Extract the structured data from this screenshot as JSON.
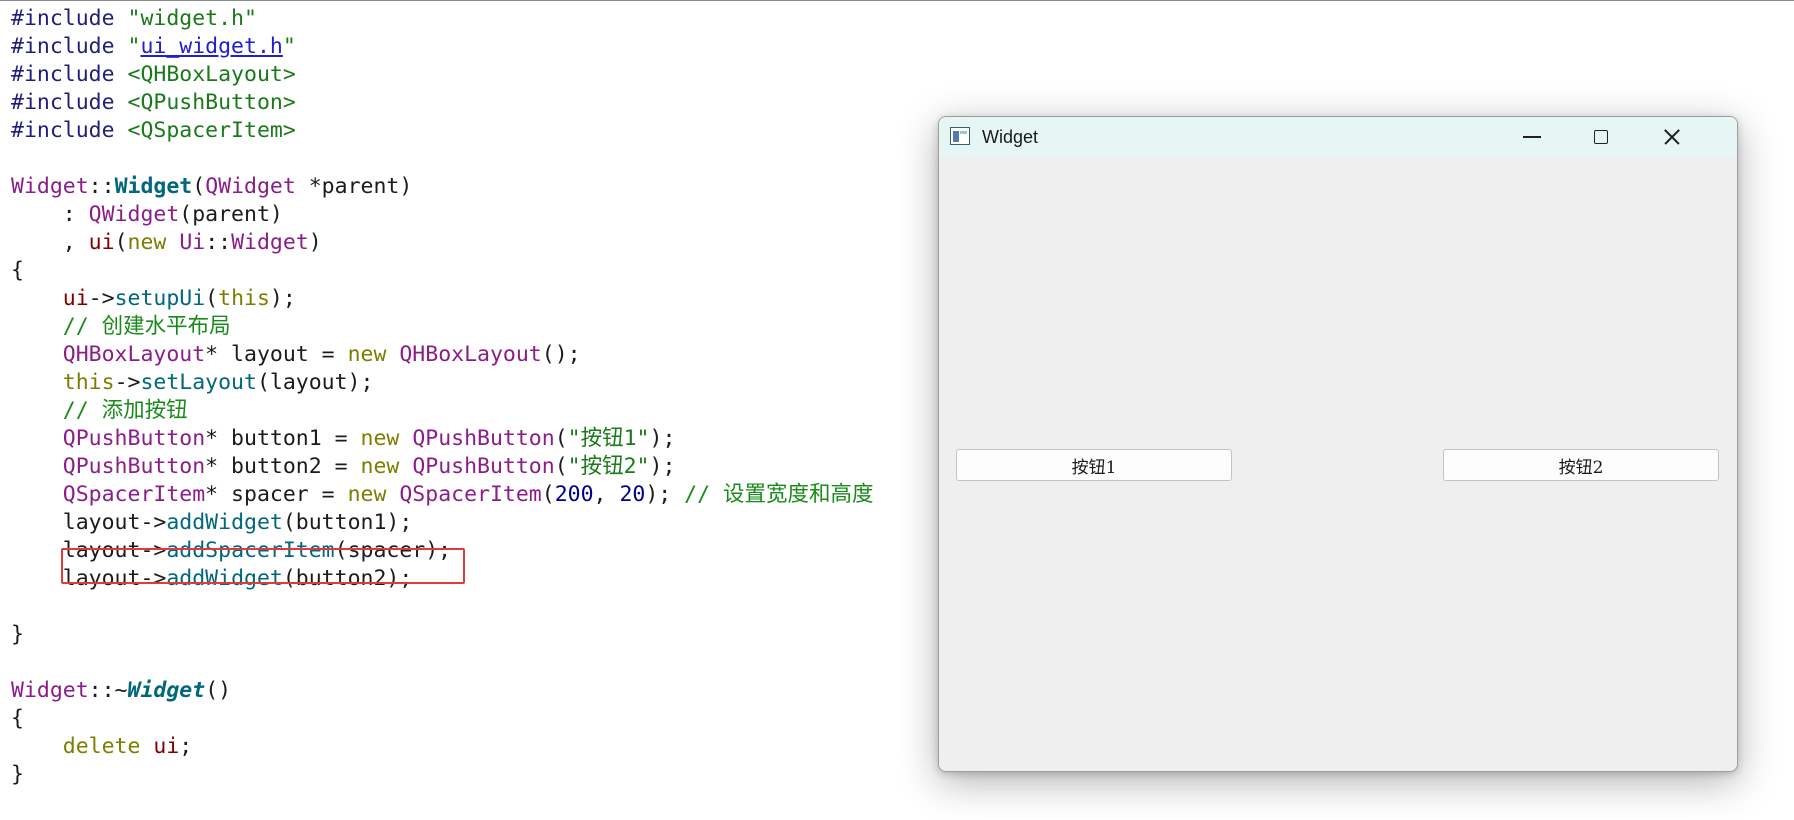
{
  "editor": {
    "lines": [
      {
        "row": 0,
        "tokens": [
          [
            "pp",
            "#include "
          ],
          [
            "str",
            "\"widget.h\""
          ]
        ]
      },
      {
        "row": 1,
        "tokens": [
          [
            "pp",
            "#include "
          ],
          [
            "str",
            "\""
          ],
          [
            "lnk",
            "ui_widget.h"
          ],
          [
            "str",
            "\""
          ]
        ]
      },
      {
        "row": 2,
        "tokens": [
          [
            "pp",
            "#include "
          ],
          [
            "str",
            "<QHBoxLayout>"
          ]
        ]
      },
      {
        "row": 3,
        "tokens": [
          [
            "pp",
            "#include "
          ],
          [
            "str",
            "<QPushButton>"
          ]
        ]
      },
      {
        "row": 4,
        "tokens": [
          [
            "pp",
            "#include "
          ],
          [
            "str",
            "<QSpacerItem>"
          ]
        ]
      },
      {
        "row": 6,
        "tokens": [
          [
            "type",
            "Widget"
          ],
          [
            "plain",
            "::"
          ],
          [
            "fnb",
            "Widget"
          ],
          [
            "plain",
            "("
          ],
          [
            "type",
            "QWidget"
          ],
          [
            "plain",
            " *parent)"
          ]
        ]
      },
      {
        "row": 7,
        "tokens": [
          [
            "plain",
            "    : "
          ],
          [
            "type",
            "QWidget"
          ],
          [
            "plain",
            "(parent)"
          ]
        ]
      },
      {
        "row": 8,
        "tokens": [
          [
            "plain",
            "    , "
          ],
          [
            "var",
            "ui"
          ],
          [
            "plain",
            "("
          ],
          [
            "kw",
            "new"
          ],
          [
            "plain",
            " "
          ],
          [
            "type",
            "Ui"
          ],
          [
            "plain",
            "::"
          ],
          [
            "type",
            "Widget"
          ],
          [
            "plain",
            ")"
          ]
        ]
      },
      {
        "row": 9,
        "tokens": [
          [
            "plain",
            "{"
          ]
        ]
      },
      {
        "row": 10,
        "tokens": [
          [
            "plain",
            "    "
          ],
          [
            "var",
            "ui"
          ],
          [
            "plain",
            "->"
          ],
          [
            "fn",
            "setupUi"
          ],
          [
            "plain",
            "("
          ],
          [
            "kw",
            "this"
          ],
          [
            "plain",
            ");"
          ]
        ]
      },
      {
        "row": 11,
        "tokens": [
          [
            "plain",
            "    "
          ],
          [
            "cmt",
            "// 创建水平布局"
          ]
        ]
      },
      {
        "row": 12,
        "tokens": [
          [
            "plain",
            "    "
          ],
          [
            "type",
            "QHBoxLayout"
          ],
          [
            "plain",
            "* layout = "
          ],
          [
            "kw",
            "new"
          ],
          [
            "plain",
            " "
          ],
          [
            "type",
            "QHBoxLayout"
          ],
          [
            "plain",
            "();"
          ]
        ]
      },
      {
        "row": 13,
        "tokens": [
          [
            "plain",
            "    "
          ],
          [
            "kw",
            "this"
          ],
          [
            "plain",
            "->"
          ],
          [
            "fn",
            "setLayout"
          ],
          [
            "plain",
            "(layout);"
          ]
        ]
      },
      {
        "row": 14,
        "tokens": [
          [
            "plain",
            "    "
          ],
          [
            "cmt",
            "// 添加按钮"
          ]
        ]
      },
      {
        "row": 15,
        "tokens": [
          [
            "plain",
            "    "
          ],
          [
            "type",
            "QPushButton"
          ],
          [
            "plain",
            "* button1 = "
          ],
          [
            "kw",
            "new"
          ],
          [
            "plain",
            " "
          ],
          [
            "type",
            "QPushButton"
          ],
          [
            "plain",
            "("
          ],
          [
            "str",
            "\"按钮1\""
          ],
          [
            "plain",
            ");"
          ]
        ]
      },
      {
        "row": 16,
        "tokens": [
          [
            "plain",
            "    "
          ],
          [
            "type",
            "QPushButton"
          ],
          [
            "plain",
            "* button2 = "
          ],
          [
            "kw",
            "new"
          ],
          [
            "plain",
            " "
          ],
          [
            "type",
            "QPushButton"
          ],
          [
            "plain",
            "("
          ],
          [
            "str",
            "\"按钮2\""
          ],
          [
            "plain",
            ");"
          ]
        ]
      },
      {
        "row": 17,
        "tokens": [
          [
            "plain",
            "    "
          ],
          [
            "type",
            "QSpacerItem"
          ],
          [
            "plain",
            "* spacer = "
          ],
          [
            "kw",
            "new"
          ],
          [
            "plain",
            " "
          ],
          [
            "type",
            "QSpacerItem"
          ],
          [
            "plain",
            "("
          ],
          [
            "num",
            "200"
          ],
          [
            "plain",
            ", "
          ],
          [
            "num",
            "20"
          ],
          [
            "plain",
            "); "
          ],
          [
            "cmt",
            "// 设置宽度和高度"
          ]
        ]
      },
      {
        "row": 18,
        "tokens": [
          [
            "plain",
            "    layout->"
          ],
          [
            "fn",
            "addWidget"
          ],
          [
            "plain",
            "(button1);"
          ]
        ]
      },
      {
        "row": 19,
        "tokens": [
          [
            "plain",
            "    layout->"
          ],
          [
            "fn",
            "addSpacerItem"
          ],
          [
            "plain",
            "(spacer);"
          ]
        ]
      },
      {
        "row": 20,
        "tokens": [
          [
            "plain",
            "    layout->"
          ],
          [
            "fn",
            "addWidget"
          ],
          [
            "plain",
            "(button2);"
          ]
        ]
      },
      {
        "row": 22,
        "tokens": [
          [
            "plain",
            "}"
          ]
        ]
      },
      {
        "row": 24,
        "tokens": [
          [
            "type",
            "Widget"
          ],
          [
            "plain",
            "::~"
          ],
          [
            "fnbi",
            "Widget"
          ],
          [
            "plain",
            "()"
          ]
        ]
      },
      {
        "row": 25,
        "tokens": [
          [
            "plain",
            "{"
          ]
        ]
      },
      {
        "row": 26,
        "tokens": [
          [
            "plain",
            "    "
          ],
          [
            "kw",
            "delete"
          ],
          [
            "plain",
            " "
          ],
          [
            "var",
            "ui"
          ],
          [
            "plain",
            ";"
          ]
        ]
      },
      {
        "row": 27,
        "tokens": [
          [
            "plain",
            "}"
          ]
        ]
      }
    ]
  },
  "window": {
    "title": "Widget",
    "icon": "qt-app-icon",
    "controls": {
      "minimize": "minimize-icon",
      "maximize": "maximize-icon",
      "close": "close-icon"
    },
    "buttons": [
      {
        "label": "按钮1"
      },
      {
        "label": "按钮2"
      }
    ]
  },
  "colors": {
    "highlight_box": "#e03a3a",
    "titlebar_bg": "#e6f6f4",
    "window_bg": "#efefef"
  }
}
